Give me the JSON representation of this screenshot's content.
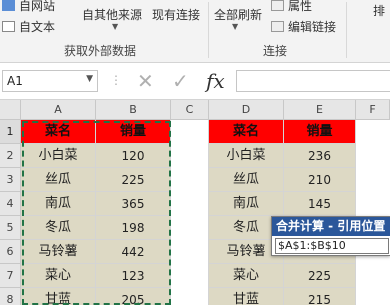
{
  "ribbon": {
    "get_external": {
      "from_web": "自网站",
      "from_text": "自文本",
      "from_other": "自其他来源",
      "existing": "现有连接",
      "group_label": "获取外部数据"
    },
    "connections": {
      "refresh_all": "全部刷新",
      "properties": "属性",
      "edit_links": "编辑链接",
      "group_label": "连接",
      "sort": "排"
    }
  },
  "formula_bar": {
    "name_box": "A1",
    "fx_label": "fx",
    "value": ""
  },
  "columns": [
    "A",
    "B",
    "C",
    "D",
    "E",
    "F"
  ],
  "rows": [
    "1",
    "2",
    "3",
    "4",
    "5",
    "6",
    "7",
    "8"
  ],
  "table_left": {
    "headers": [
      "菜名",
      "销量"
    ],
    "rows": [
      [
        "小白菜",
        "120"
      ],
      [
        "丝瓜",
        "225"
      ],
      [
        "南瓜",
        "365"
      ],
      [
        "冬瓜",
        "198"
      ],
      [
        "马铃薯",
        "442"
      ],
      [
        "菜心",
        "123"
      ],
      [
        "甘蓝",
        "205"
      ]
    ]
  },
  "table_right": {
    "headers": [
      "菜名",
      "销量"
    ],
    "rows": [
      [
        "小白菜",
        "236"
      ],
      [
        "丝瓜",
        "210"
      ],
      [
        "南瓜",
        "145"
      ],
      [
        "冬瓜",
        ""
      ],
      [
        "马铃薯",
        ""
      ],
      [
        "菜心",
        "225"
      ],
      [
        "甘蓝",
        "215"
      ]
    ]
  },
  "dialog": {
    "title": "合并计算 - 引用位置",
    "reference": "$A$1:$B$10"
  },
  "colors": {
    "header_red": "#ff0000",
    "body_tan": "#ddd9c4",
    "marquee_green": "#217346",
    "dialog_blue": "#2b579a"
  }
}
